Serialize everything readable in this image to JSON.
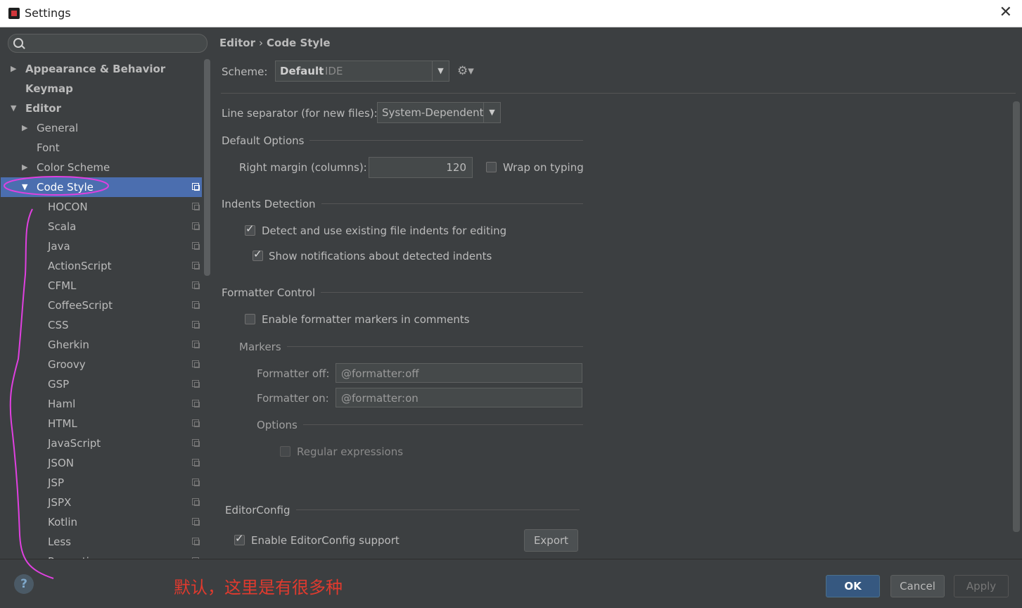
{
  "window": {
    "title": "Settings"
  },
  "sidebar": {
    "search_placeholder": "",
    "items": [
      {
        "label": "Appearance & Behavior",
        "bold": true,
        "arrow": "right",
        "indent": 0
      },
      {
        "label": "Keymap",
        "bold": true,
        "arrow": "",
        "indent": 0
      },
      {
        "label": "Editor",
        "bold": true,
        "arrow": "down",
        "indent": 0
      },
      {
        "label": "General",
        "bold": false,
        "arrow": "right",
        "indent": 1
      },
      {
        "label": "Font",
        "bold": false,
        "arrow": "",
        "indent": 1
      },
      {
        "label": "Color Scheme",
        "bold": false,
        "arrow": "right",
        "indent": 1
      },
      {
        "label": "Code Style",
        "bold": false,
        "arrow": "down",
        "indent": 1,
        "selected": true
      },
      {
        "label": "HOCON",
        "indent": 2
      },
      {
        "label": "Scala",
        "indent": 2
      },
      {
        "label": "Java",
        "indent": 2
      },
      {
        "label": "ActionScript",
        "indent": 2
      },
      {
        "label": "CFML",
        "indent": 2
      },
      {
        "label": "CoffeeScript",
        "indent": 2
      },
      {
        "label": "CSS",
        "indent": 2
      },
      {
        "label": "Gherkin",
        "indent": 2
      },
      {
        "label": "Groovy",
        "indent": 2
      },
      {
        "label": "GSP",
        "indent": 2
      },
      {
        "label": "Haml",
        "indent": 2
      },
      {
        "label": "HTML",
        "indent": 2
      },
      {
        "label": "JavaScript",
        "indent": 2
      },
      {
        "label": "JSON",
        "indent": 2
      },
      {
        "label": "JSP",
        "indent": 2
      },
      {
        "label": "JSPX",
        "indent": 2
      },
      {
        "label": "Kotlin",
        "indent": 2
      },
      {
        "label": "Less",
        "indent": 2
      },
      {
        "label": "Properties",
        "indent": 2
      }
    ]
  },
  "main": {
    "breadcrumb": {
      "parent": "Editor",
      "separator": "›",
      "current": "Code Style"
    },
    "scheme": {
      "label": "Scheme:",
      "name": "Default",
      "tag": "IDE"
    },
    "line_separator": {
      "label": "Line separator (for new files):",
      "value": "System-Dependent"
    },
    "default_options": {
      "title": "Default Options",
      "right_margin_label": "Right margin (columns):",
      "right_margin_value": "120",
      "wrap_on_typing": "Wrap on typing"
    },
    "indents_detection": {
      "title": "Indents Detection",
      "detect_label": "Detect and use existing file indents for editing",
      "notify_label": "Show notifications about detected indents"
    },
    "formatter_control": {
      "title": "Formatter Control",
      "enable_markers": "Enable formatter markers in comments",
      "markers_title": "Markers",
      "off_label": "Formatter off:",
      "off_value": "@formatter:off",
      "on_label": "Formatter on:",
      "on_value": "@formatter:on",
      "options_title": "Options",
      "regex_label": "Regular expressions"
    },
    "editorconfig": {
      "title": "EditorConfig",
      "enable_label": "Enable EditorConfig support",
      "export_label": "Export"
    }
  },
  "footer": {
    "help": "?",
    "annotation": "默认，这里是有很多种",
    "ok": "OK",
    "cancel": "Cancel",
    "apply": "Apply"
  },
  "colors": {
    "selection": "#4b6eaf",
    "annotation_ink": "#e040e0",
    "annotation_text": "#e03a2e"
  }
}
